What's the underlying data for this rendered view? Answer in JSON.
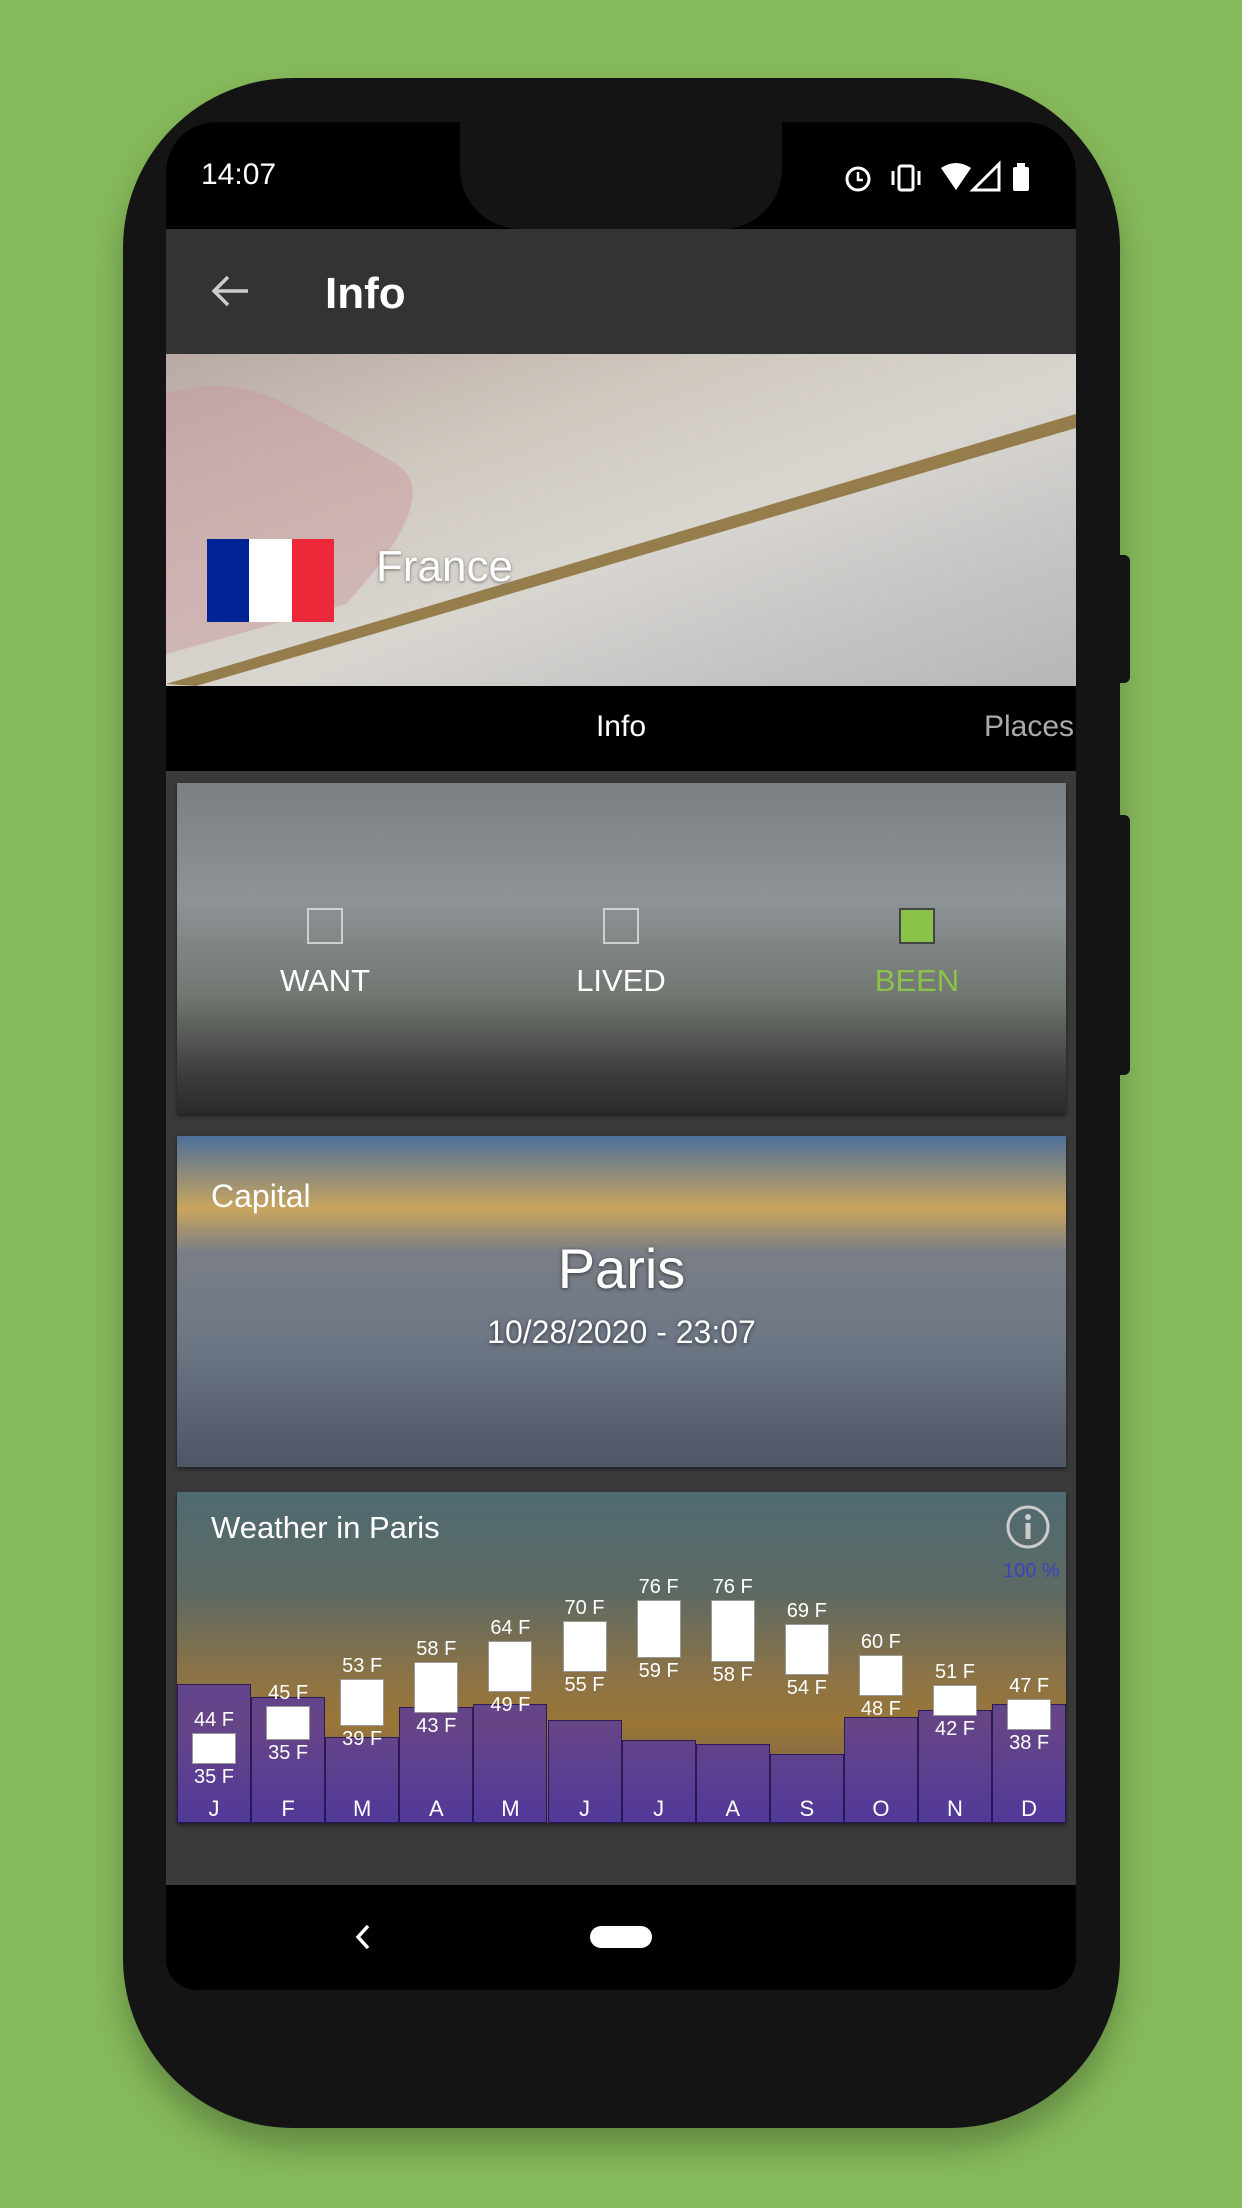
{
  "status_bar": {
    "time": "14:07",
    "icons": [
      "alarm-icon",
      "vibrate-icon",
      "wifi-icon",
      "signal-icon",
      "battery-icon"
    ]
  },
  "app_bar": {
    "title": "Info",
    "back_icon": "arrow-left-icon"
  },
  "hero": {
    "country": "France",
    "flag_colors": [
      "#002395",
      "#ffffff",
      "#ed2939"
    ]
  },
  "tabs": [
    {
      "label": "Info",
      "selected": true
    },
    {
      "label": "Places",
      "selected": false
    }
  ],
  "status_card": {
    "options": [
      {
        "label": "WANT",
        "checked": false
      },
      {
        "label": "LIVED",
        "checked": false
      },
      {
        "label": "BEEN",
        "checked": true
      }
    ],
    "accent": "#8bc34a"
  },
  "capital_card": {
    "label": "Capital",
    "city": "Paris",
    "datetime": "10/28/2020 - 23:07"
  },
  "weather_card": {
    "title": "Weather in Paris",
    "info_icon": "info-circle-icon",
    "percent_link": "100 %"
  },
  "chart_data": {
    "type": "bar",
    "categories": [
      "J",
      "F",
      "M",
      "A",
      "M",
      "J",
      "J",
      "A",
      "S",
      "O",
      "N",
      "D"
    ],
    "series": [
      {
        "name": "high",
        "values": [
          44,
          45,
          53,
          58,
          64,
          70,
          76,
          76,
          69,
          60,
          51,
          47
        ],
        "labels": [
          "44 F",
          "45 F",
          "53 F",
          "58 F",
          "64 F",
          "70 F",
          "76 F",
          "76 F",
          "69 F",
          "60 F",
          "51 F",
          "47 F"
        ]
      },
      {
        "name": "low",
        "values": [
          35,
          35,
          39,
          43,
          49,
          55,
          59,
          58,
          54,
          48,
          42,
          38
        ],
        "labels": [
          "35 F",
          "35 F",
          "39 F",
          "43 F",
          "49 F",
          "55 F",
          "59 F",
          "58 F",
          "54 F",
          "48 F",
          "42 F",
          "38 F"
        ]
      }
    ],
    "background_bar_levels": [
      0.42,
      0.38,
      0.26,
      0.35,
      0.36,
      0.31,
      0.25,
      0.24,
      0.21,
      0.32,
      0.34,
      0.36
    ]
  },
  "nav_bar": {
    "back_icon": "chevron-left-icon",
    "home_icon": "home-pill-icon"
  }
}
